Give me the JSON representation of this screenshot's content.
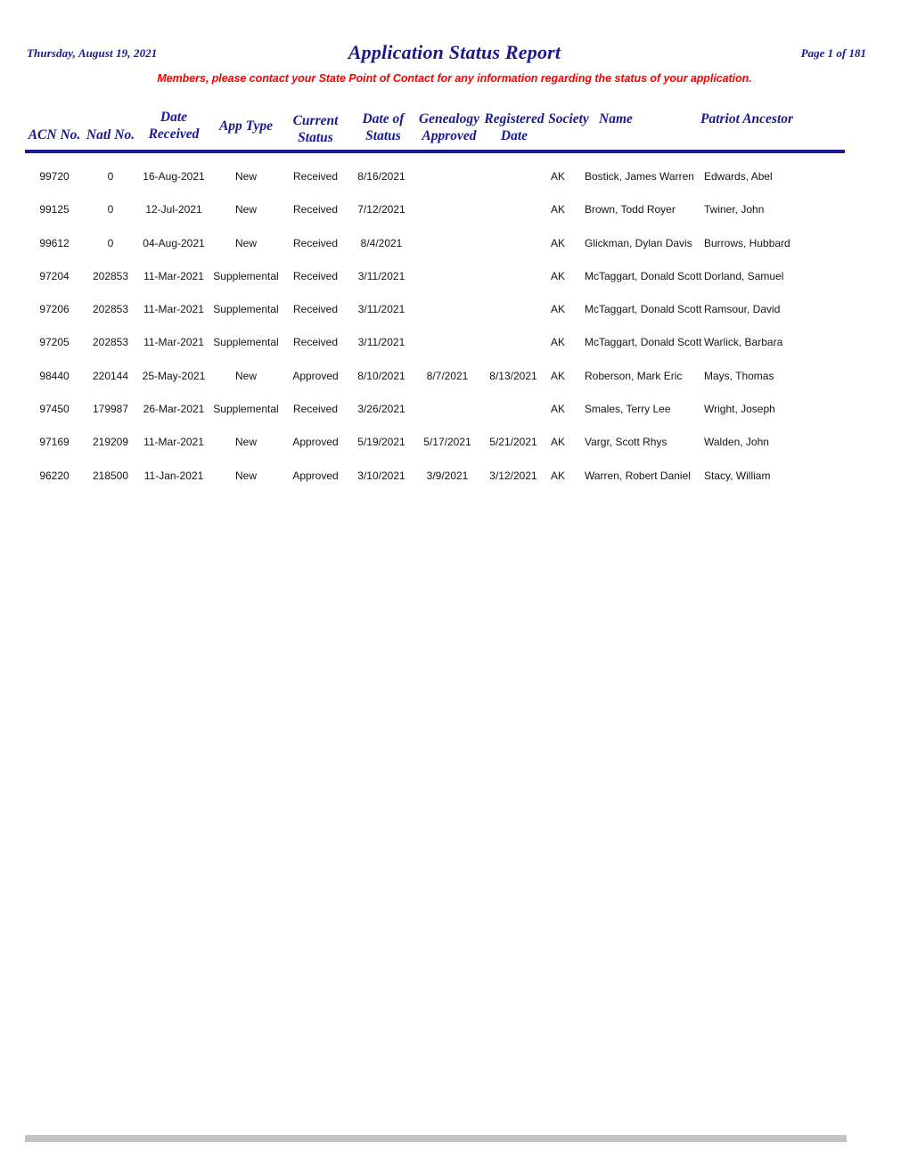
{
  "header": {
    "date": "Thursday, August 19, 2021",
    "title": "Application Status Report",
    "page_label": "Page 1 of 181",
    "notice": "Members, please contact your State Point of Contact for any information regarding the status of your application."
  },
  "colors": {
    "heading_navy": "#1a1a8e",
    "notice_red": "#ff0000",
    "body_text": "#151515",
    "footer_bar": "#c4c4c4"
  },
  "table": {
    "columns": [
      "ACN No.",
      "Natl No.",
      "Date\nReceived",
      "App Type",
      "Current\nStatus",
      "Date of\nStatus",
      "Genealogy\nApproved",
      "Registered\nDate",
      "Society",
      "Name",
      "Patriot Ancestor"
    ],
    "rows": [
      {
        "acn_no": "99720",
        "natl_no": "0",
        "date_received": "16-Aug-2021",
        "app_type": "New",
        "current_status": "Received",
        "date_of_status": "8/16/2021",
        "genealogy_approved": "",
        "registered_date": "",
        "society": "AK",
        "name": "Bostick,  James Warren",
        "patriot_ancestor": "Edwards, Abel"
      },
      {
        "acn_no": "99125",
        "natl_no": "0",
        "date_received": "12-Jul-2021",
        "app_type": "New",
        "current_status": "Received",
        "date_of_status": "7/12/2021",
        "genealogy_approved": "",
        "registered_date": "",
        "society": "AK",
        "name": "Brown,  Todd Royer",
        "patriot_ancestor": "Twiner, John"
      },
      {
        "acn_no": "99612",
        "natl_no": "0",
        "date_received": "04-Aug-2021",
        "app_type": "New",
        "current_status": "Received",
        "date_of_status": "8/4/2021",
        "genealogy_approved": "",
        "registered_date": "",
        "society": "AK",
        "name": "Glickman,  Dylan Davis",
        "patriot_ancestor": "Burrows, Hubbard"
      },
      {
        "acn_no": "97204",
        "natl_no": "202853",
        "date_received": "11-Mar-2021",
        "app_type": "Supplemental",
        "current_status": "Received",
        "date_of_status": "3/11/2021",
        "genealogy_approved": "",
        "registered_date": "",
        "society": "AK",
        "name": "McTaggart,  Donald Scott",
        "patriot_ancestor": "Dorland, Samuel"
      },
      {
        "acn_no": "97206",
        "natl_no": "202853",
        "date_received": "11-Mar-2021",
        "app_type": "Supplemental",
        "current_status": "Received",
        "date_of_status": "3/11/2021",
        "genealogy_approved": "",
        "registered_date": "",
        "society": "AK",
        "name": "McTaggart,  Donald Scott",
        "patriot_ancestor": "Ramsour, David"
      },
      {
        "acn_no": "97205",
        "natl_no": "202853",
        "date_received": "11-Mar-2021",
        "app_type": "Supplemental",
        "current_status": "Received",
        "date_of_status": "3/11/2021",
        "genealogy_approved": "",
        "registered_date": "",
        "society": "AK",
        "name": "McTaggart,  Donald Scott",
        "patriot_ancestor": "Warlick, Barbara"
      },
      {
        "acn_no": "98440",
        "natl_no": "220144",
        "date_received": "25-May-2021",
        "app_type": "New",
        "current_status": "Approved",
        "date_of_status": "8/10/2021",
        "genealogy_approved": "8/7/2021",
        "registered_date": "8/13/2021",
        "society": "AK",
        "name": "Roberson,  Mark Eric",
        "patriot_ancestor": "Mays, Thomas"
      },
      {
        "acn_no": "97450",
        "natl_no": "179987",
        "date_received": "26-Mar-2021",
        "app_type": "Supplemental",
        "current_status": "Received",
        "date_of_status": "3/26/2021",
        "genealogy_approved": "",
        "registered_date": "",
        "society": "AK",
        "name": "Smales,  Terry Lee",
        "patriot_ancestor": "Wright, Joseph"
      },
      {
        "acn_no": "97169",
        "natl_no": "219209",
        "date_received": "11-Mar-2021",
        "app_type": "New",
        "current_status": "Approved",
        "date_of_status": "5/19/2021",
        "genealogy_approved": "5/17/2021",
        "registered_date": "5/21/2021",
        "society": "AK",
        "name": "Vargr,  Scott Rhys",
        "patriot_ancestor": "Walden, John"
      },
      {
        "acn_no": "96220",
        "natl_no": "218500",
        "date_received": "11-Jan-2021",
        "app_type": "New",
        "current_status": "Approved",
        "date_of_status": "3/10/2021",
        "genealogy_approved": "3/9/2021",
        "registered_date": "3/12/2021",
        "society": "AK",
        "name": "Warren,  Robert Daniel",
        "patriot_ancestor": "Stacy, William"
      }
    ]
  }
}
